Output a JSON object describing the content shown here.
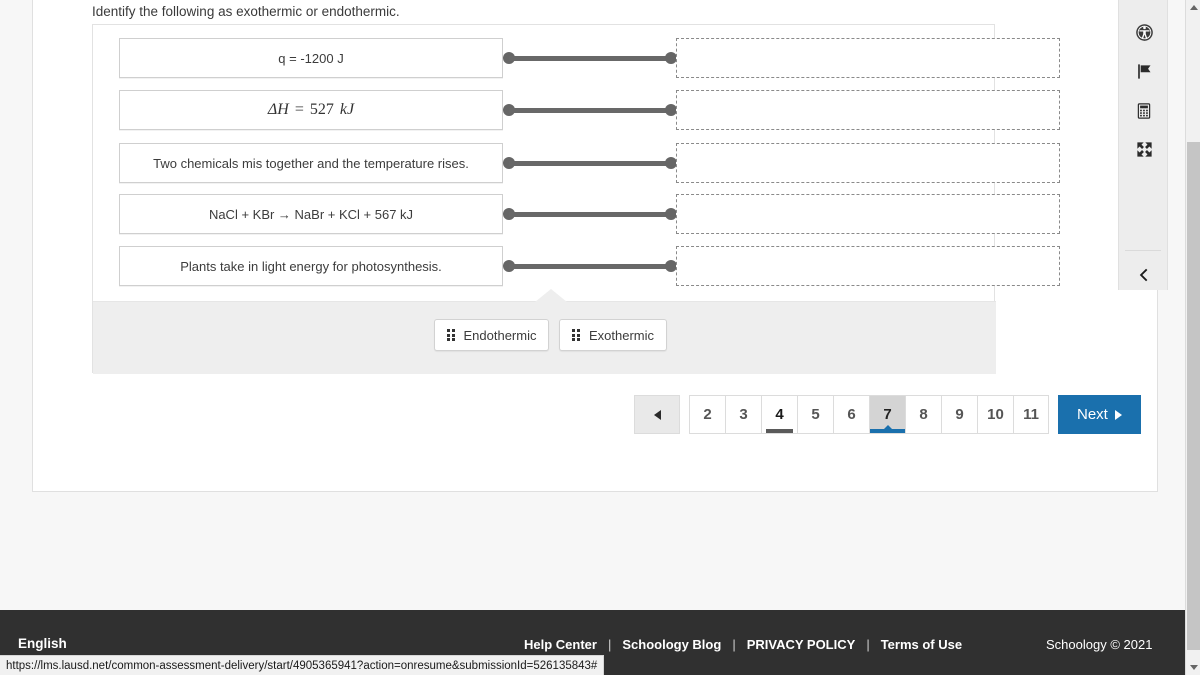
{
  "question": {
    "prompt": "Identify the following as exothermic or endothermic.",
    "items": [
      {
        "text": "q = -1200 J",
        "math": false
      },
      {
        "text": "ΔH  =  527 kJ",
        "math": true,
        "math_parts": {
          "delta": "ΔH",
          "eq": "=",
          "value": "527",
          "unit": "kJ"
        }
      },
      {
        "text": "Two chemicals mis together and the temperature rises.",
        "math": false
      },
      {
        "text": "NaCl + KBr → NaBr + KCl + 567 kJ",
        "math": false
      },
      {
        "text": "Plants take in light energy for photosynthesis.",
        "math": false
      }
    ],
    "drop_zone_placeholder": ""
  },
  "answer_bank": {
    "tokens": [
      {
        "label": "Endothermic",
        "handle_icon": "drag-handle-icon"
      },
      {
        "label": "Exothermic",
        "handle_icon": "drag-handle-icon"
      }
    ]
  },
  "pagination": {
    "prev_icon": "triangle-left-icon",
    "pages": [
      {
        "label": "2",
        "state": "normal"
      },
      {
        "label": "3",
        "state": "normal"
      },
      {
        "label": "4",
        "state": "answered"
      },
      {
        "label": "5",
        "state": "normal"
      },
      {
        "label": "6",
        "state": "normal"
      },
      {
        "label": "7",
        "state": "current"
      },
      {
        "label": "8",
        "state": "normal"
      },
      {
        "label": "9",
        "state": "normal"
      },
      {
        "label": "10",
        "state": "normal"
      },
      {
        "label": "11",
        "state": "normal"
      }
    ],
    "next_label": "Next",
    "next_icon": "triangle-right-icon"
  },
  "tool_rail": {
    "buttons": [
      {
        "icon": "accessibility-icon",
        "name": "accessibility-button"
      },
      {
        "icon": "flag-icon",
        "name": "flag-question-button"
      },
      {
        "icon": "calculator-icon",
        "name": "calculator-button"
      },
      {
        "icon": "fullscreen-icon",
        "name": "fullscreen-button"
      }
    ],
    "collapse_icon": "chevron-left-icon"
  },
  "footer": {
    "language": "English",
    "links": [
      "Help Center",
      "Schoology Blog",
      "PRIVACY POLICY",
      "Terms of Use"
    ],
    "separator": "|",
    "copyright": "Schoology © 2021"
  },
  "status_bar": {
    "url": "https://lms.lausd.net/common-assessment-delivery/start/4905365941?action=onresume&submissionId=526135843#"
  },
  "colors": {
    "accent_blue": "#1a70ad",
    "footer_bg": "#303030",
    "tray_bg": "#eeeeee",
    "connector": "#666666",
    "answered_underline": "#5a5a5a"
  }
}
